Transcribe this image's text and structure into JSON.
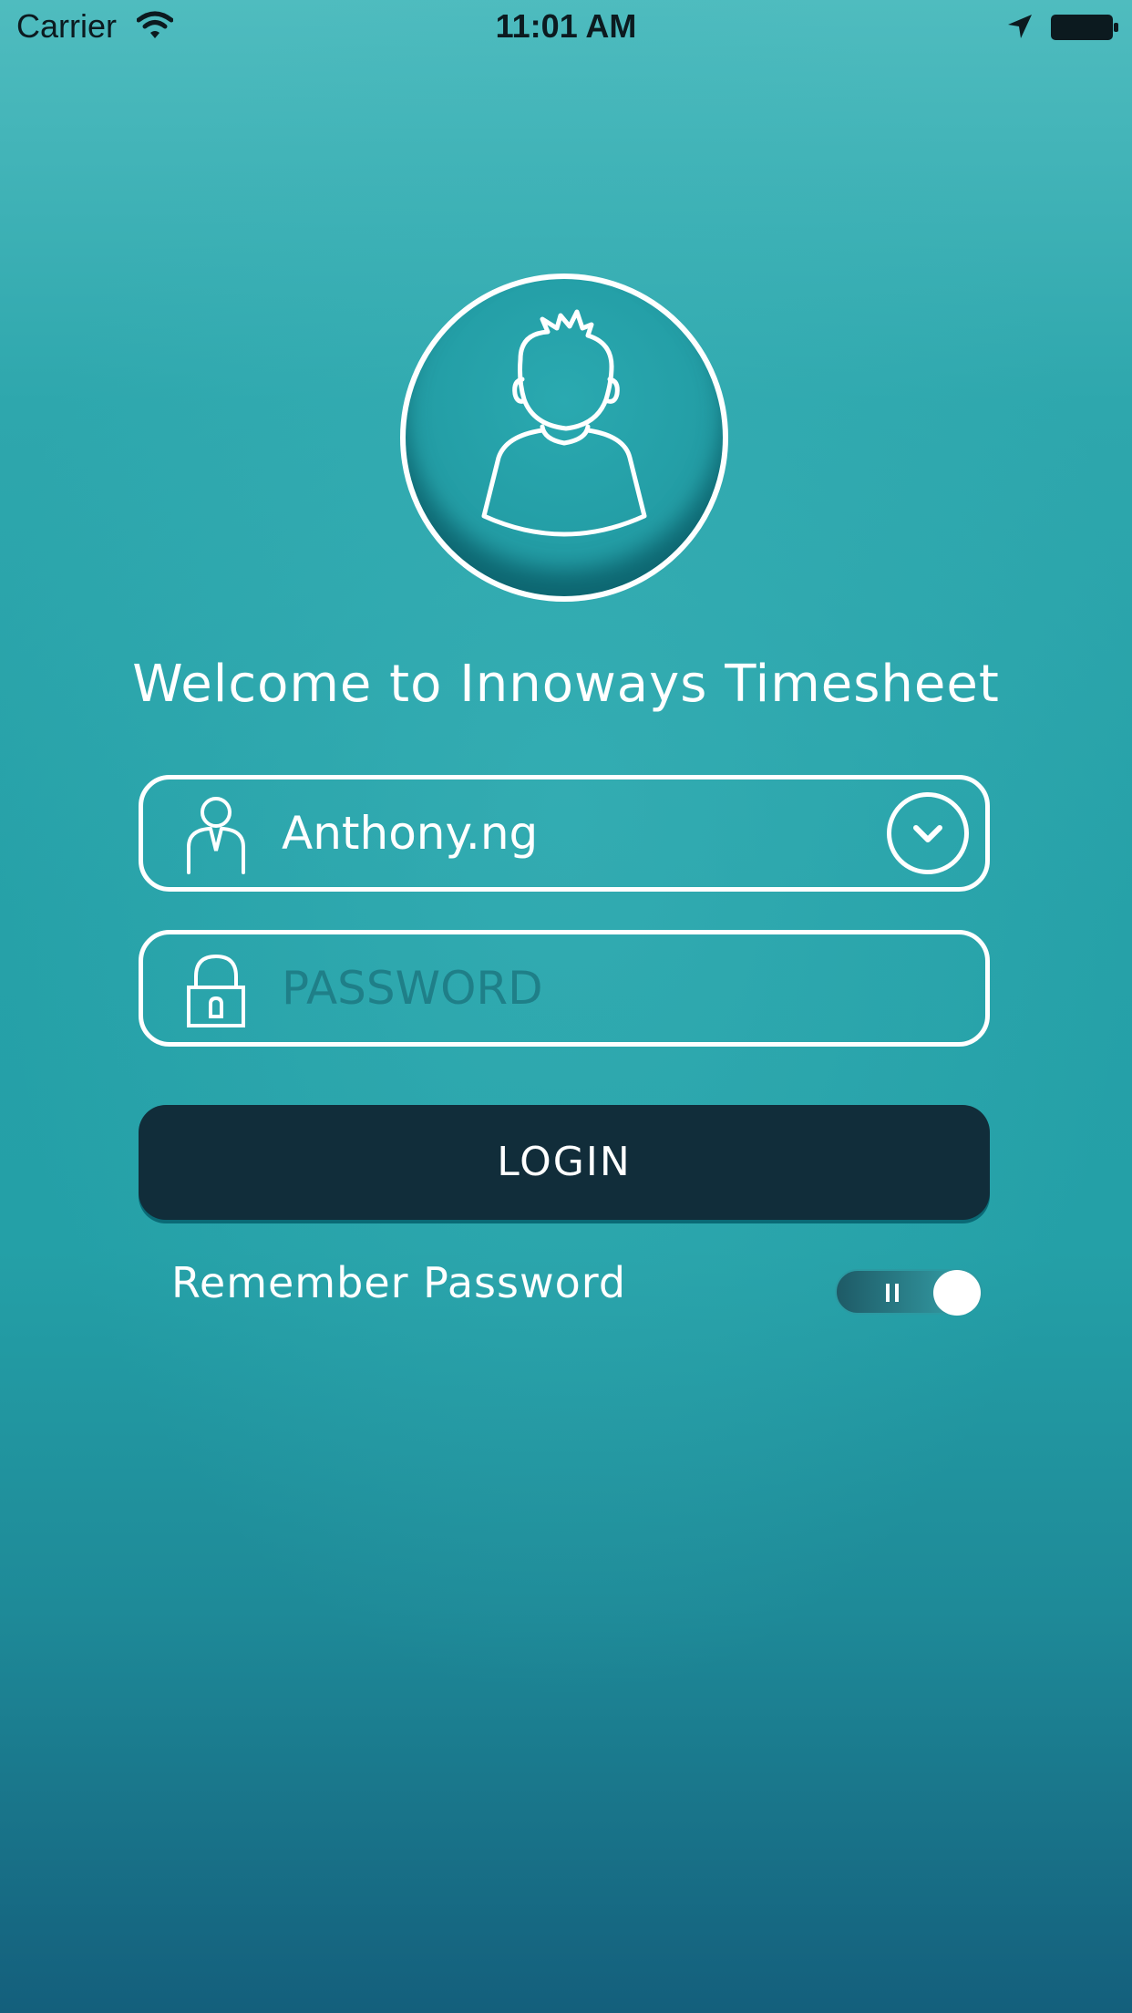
{
  "status_bar": {
    "carrier": "Carrier",
    "time": "11:01 AM",
    "icons": [
      "wifi-icon",
      "location-arrow-icon",
      "battery-icon"
    ]
  },
  "avatar": {
    "icon": "user-avatar-icon"
  },
  "welcome_text": "Welcome to Innoways Timesheet",
  "username_field": {
    "value": "Anthony.ng",
    "icon": "user-icon",
    "dropdown_icon": "chevron-down-icon"
  },
  "password_field": {
    "placeholder": "PASSWORD",
    "icon": "lock-icon"
  },
  "login_button": {
    "label": "LOGIN"
  },
  "remember": {
    "label": "Remember Password",
    "toggle_state": "on"
  },
  "colors": {
    "background_top": "#4fbcbf",
    "background_mid": "#24a0a7",
    "background_bottom": "#145f7c",
    "button": "#112d3a",
    "text": "#ffffff",
    "placeholder": "#1f7f88"
  }
}
